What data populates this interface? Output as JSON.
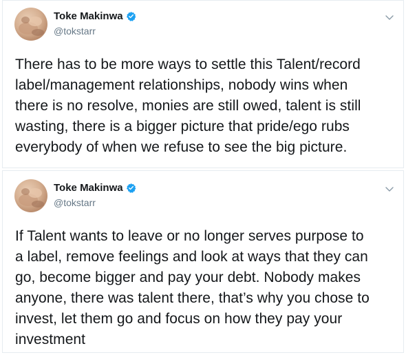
{
  "colors": {
    "text_primary": "#14171a",
    "text_secondary": "#657786",
    "verified_blue": "#1da1f2",
    "border": "#e6ecf0"
  },
  "tweets": [
    {
      "author": {
        "display_name": "Toke Makinwa",
        "handle": "@tokstarr",
        "verified": true,
        "avatar_icon": "profile-photo"
      },
      "menu_icon": "chevron-down-icon",
      "text_lines": [
        "There has to be more ways to settle this Talent/record",
        "label/management relationships, nobody wins when",
        "there is no resolve, monies are still owed, talent is still",
        "wasting, there is a bigger picture that pride/ego rubs",
        "everybody of when we refuse to see the big picture."
      ]
    },
    {
      "author": {
        "display_name": "Toke Makinwa",
        "handle": "@tokstarr",
        "verified": true,
        "avatar_icon": "profile-photo"
      },
      "menu_icon": "chevron-down-icon",
      "text_lines": [
        "If Talent wants to leave or no longer serves purpose to",
        "a label, remove feelings and look at ways that they can",
        "go, become bigger and pay your debt. Nobody makes",
        "anyone, there was talent there, that’s why you chose to",
        "invest, let them go and focus on how they pay your",
        "investment"
      ]
    }
  ]
}
